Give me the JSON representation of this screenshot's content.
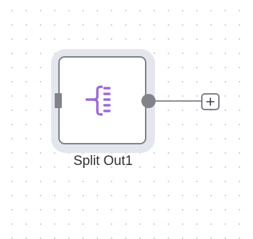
{
  "canvas": {
    "background": "#ffffff",
    "dot_color": "#c9cbd2"
  },
  "node": {
    "name": "Split Out1",
    "icon": "split-out-icon",
    "icon_color": "#9b6ad6",
    "border_color": "#7e8088",
    "selected": true
  },
  "connector": {
    "add_icon": "plus-icon"
  }
}
